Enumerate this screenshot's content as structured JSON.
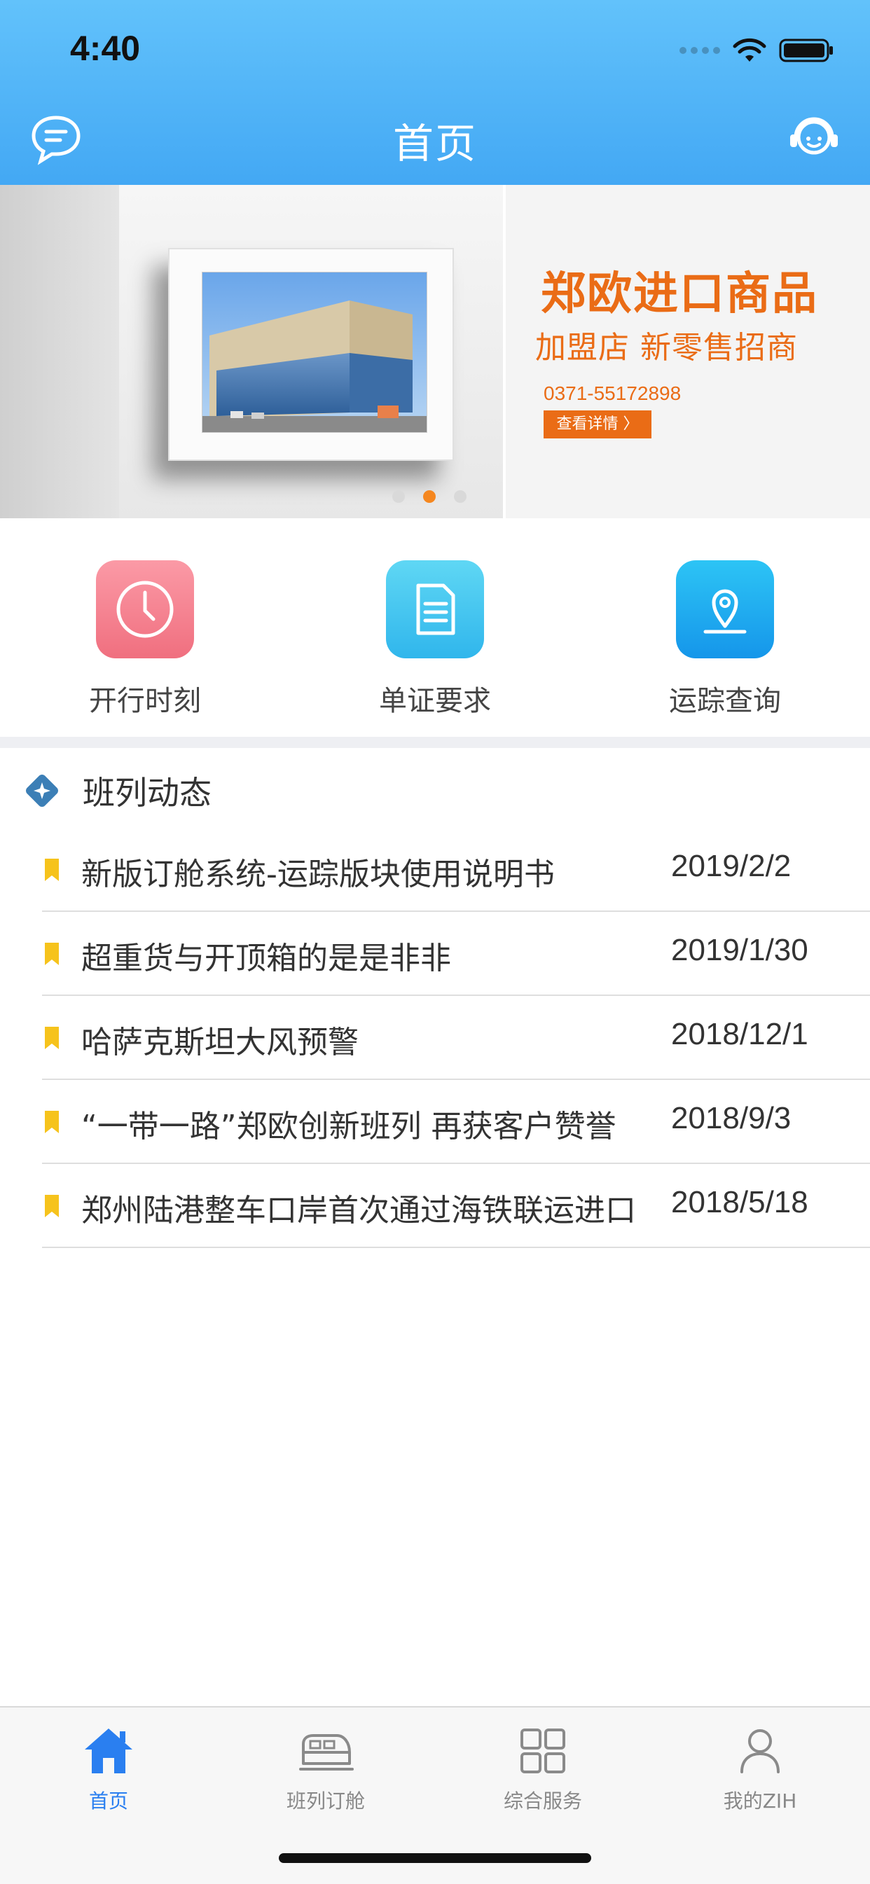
{
  "status_bar": {
    "time": "4:40"
  },
  "header": {
    "title": "首页"
  },
  "banner": {
    "title": "郑欧进口商品",
    "subtitle": "加盟店  新零售招商",
    "phone": "0371-55172898",
    "button_label": "查看详情 〉",
    "page_count": 3,
    "active_page": 2
  },
  "quick_actions": [
    {
      "label": "开行时刻",
      "icon": "clock-icon"
    },
    {
      "label": "单证要求",
      "icon": "document-icon"
    },
    {
      "label": "运踪查询",
      "icon": "location-icon"
    }
  ],
  "news": {
    "section_title": "班列动态",
    "items": [
      {
        "title": "新版订舱系统-运踪版块使用说明书",
        "date": "2019/2/2"
      },
      {
        "title": "超重货与开顶箱的是是非非",
        "date": "2019/1/30"
      },
      {
        "title": "哈萨克斯坦大风预警",
        "date": "2018/12/1"
      },
      {
        "title": "“一带一路”郑欧创新班列  再获客户赞誉",
        "date": "2018/9/3"
      },
      {
        "title": "郑州陆港整车口岸首次通过海铁联运进口",
        "date": "2018/5/18"
      }
    ]
  },
  "tabbar": {
    "items": [
      {
        "label": "首页",
        "icon": "home-icon",
        "active": true
      },
      {
        "label": "班列订舱",
        "icon": "train-icon",
        "active": false
      },
      {
        "label": "综合服务",
        "icon": "grid-icon",
        "active": false
      },
      {
        "label": "我的ZIH",
        "icon": "user-icon",
        "active": false
      }
    ]
  },
  "colors": {
    "header_blue": "#43a8f4",
    "accent_orange": "#ea6c16",
    "tab_active": "#2a7ff0",
    "bookmark_yellow": "#f6c31c"
  }
}
